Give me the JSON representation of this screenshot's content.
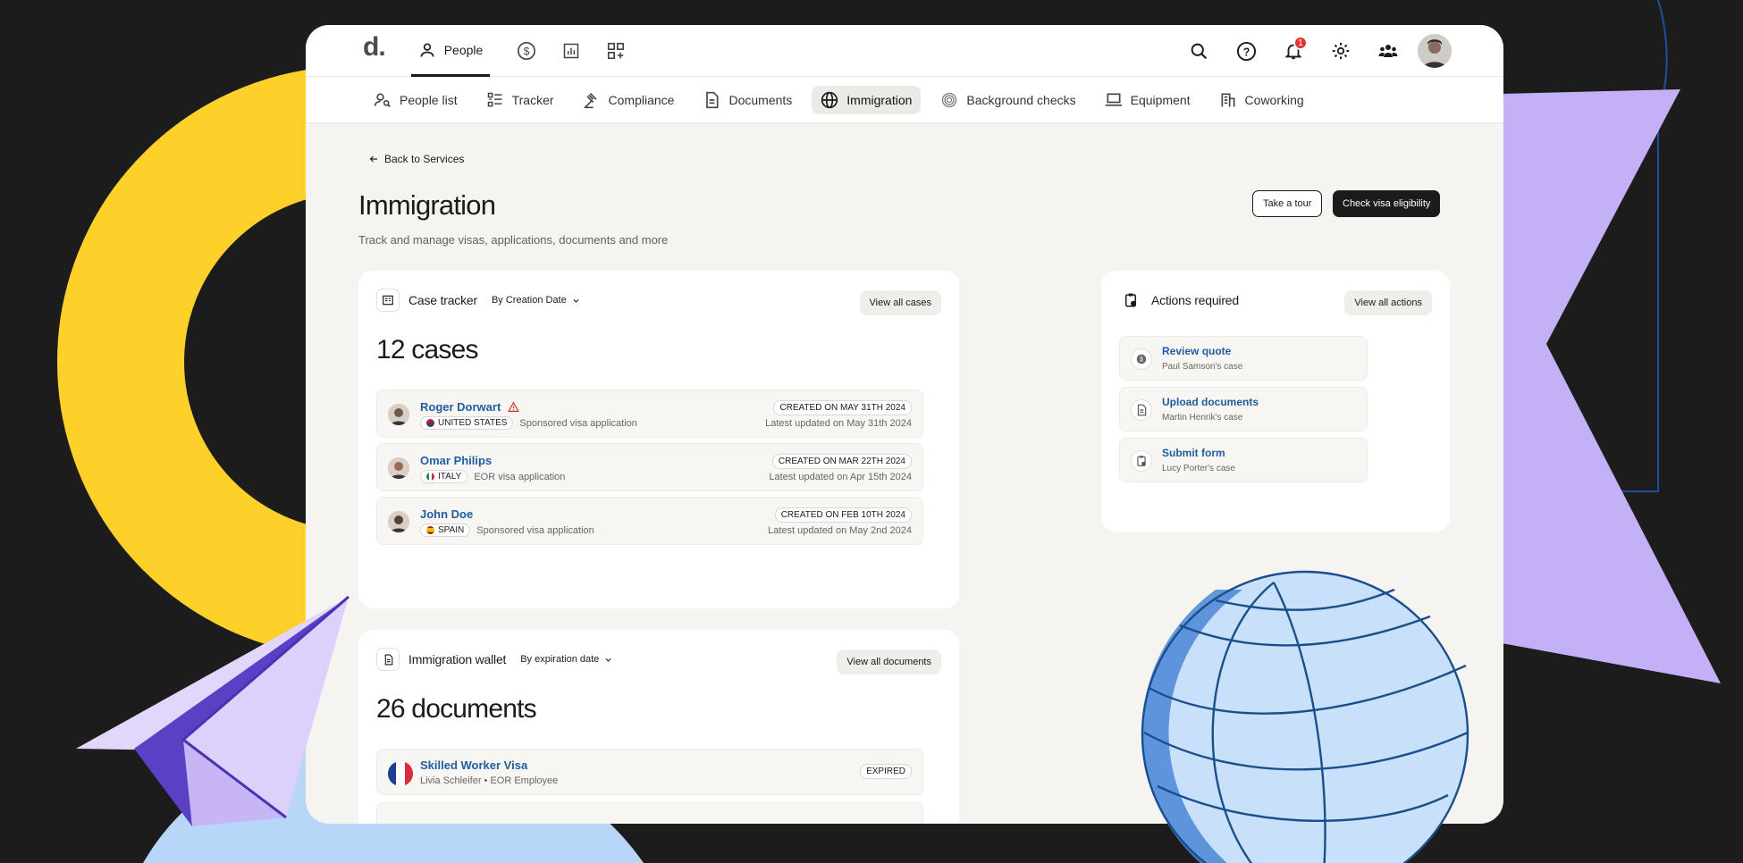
{
  "brand": {
    "logo": "d."
  },
  "topnav": {
    "people": "People",
    "icons": [
      "person-icon",
      "dollar-icon",
      "chart-icon",
      "apps-icon"
    ]
  },
  "toolbar": {
    "icons": [
      "search-icon",
      "help-icon",
      "bell-icon",
      "settings-icon",
      "team-icon"
    ],
    "notification_count": "1"
  },
  "subnav": [
    {
      "label": "People list",
      "icon": "people-search-icon",
      "active": false
    },
    {
      "label": "Tracker",
      "icon": "tracker-icon",
      "active": false
    },
    {
      "label": "Compliance",
      "icon": "gavel-icon",
      "active": false
    },
    {
      "label": "Documents",
      "icon": "document-icon",
      "active": false
    },
    {
      "label": "Immigration",
      "icon": "globe-icon",
      "active": true
    },
    {
      "label": "Background checks",
      "icon": "fingerprint-icon",
      "active": false
    },
    {
      "label": "Equipment",
      "icon": "laptop-icon",
      "active": false
    },
    {
      "label": "Coworking",
      "icon": "building-icon",
      "active": false
    }
  ],
  "page": {
    "back": "Back to Services",
    "title": "Immigration",
    "subtitle": "Track and manage visas, applications, documents and more",
    "tour": "Take a tour",
    "check": "Check visa eligibility"
  },
  "case_tracker": {
    "title": "Case tracker",
    "sort": "By Creation Date",
    "view_all": "View all cases",
    "count": "12 cases",
    "rows": [
      {
        "name": "Roger Dorwart",
        "warning": true,
        "country": "UNITED STATES",
        "type": "Sponsored visa application",
        "created": "CREATED ON MAY 31TH 2024",
        "updated": "Latest updated on May 31th 2024"
      },
      {
        "name": "Omar Philips",
        "warning": false,
        "country": "ITALY",
        "type": "EOR visa application",
        "created": "CREATED ON MAR 22TH 2024",
        "updated": "Latest updated on Apr 15th 2024"
      },
      {
        "name": "John Doe",
        "warning": false,
        "country": "SPAIN",
        "type": "Sponsored visa application",
        "created": "CREATED ON FEB 10TH 2024",
        "updated": "Latest updated on May 2nd 2024"
      }
    ]
  },
  "actions": {
    "title": "Actions required",
    "view_all": "View all actions",
    "items": [
      {
        "title": "Review quote",
        "sub": "Paul Samson's case",
        "icon": "dollar-icon"
      },
      {
        "title": "Upload documents",
        "sub": "Martin Henrik's case",
        "icon": "document-icon"
      },
      {
        "title": "Submit form",
        "sub": "Lucy Porter's case",
        "icon": "clipboard-icon"
      }
    ]
  },
  "wallet": {
    "title": "Immigration wallet",
    "sort": "By expiration date",
    "view_all": "View all documents",
    "count": "26 documents",
    "docs": [
      {
        "title": "Skilled Worker Visa",
        "sub": "Livia Schleifer • EOR Employee",
        "status": "EXPIRED"
      }
    ]
  },
  "colors": {
    "accent": "#1f5d9f",
    "yellow": "#fdd02a",
    "purple": "#c3b0f6",
    "sky": "#b7d6f8",
    "globe": "#c9e0fb",
    "globe_line": "#1a4f8e"
  }
}
